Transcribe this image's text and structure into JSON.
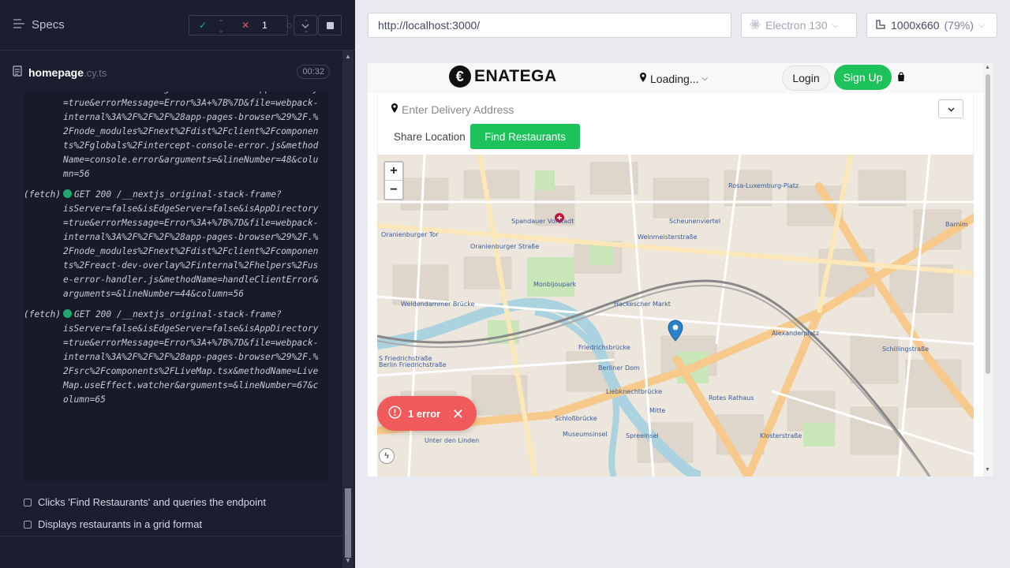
{
  "runner": {
    "specs_title": "Specs",
    "stats": {
      "passed": "--",
      "failed": "1",
      "pending": "--"
    },
    "spec_file": {
      "name": "homepage",
      "ext": ".cy.ts",
      "duration": "00:32"
    },
    "log_blocks": [
      {
        "tag": "",
        "head": "",
        "url": "isServer=false&isEdgeServer=false&isAppDirectory=true&errorMessage=Error%3A+%7B%7D&file=webpack-internal%3A%2F%2F%2F%28app-pages-browser%29%2F.%2Fnode_modules%2Fnext%2Fdist%2Fclient%2Fcomponents%2Fglobals%2Fintercept-console-error.js&methodName=console.error&arguments=&lineNumber=48&column=56"
      },
      {
        "tag": "(fetch)",
        "head": "GET 200 /__nextjs_original-stack-frame?",
        "url": "isServer=false&isEdgeServer=false&isAppDirectory=true&errorMessage=Error%3A+%7B%7D&file=webpack-internal%3A%2F%2F%2F%28app-pages-browser%29%2F.%2Fnode_modules%2Fnext%2Fdist%2Fclient%2Fcomponents%2Freact-dev-overlay%2Finternal%2Fhelpers%2Fuse-error-handler.js&methodName=handleClientError&arguments=&lineNumber=44&column=56"
      },
      {
        "tag": "(fetch)",
        "head": "GET 200 /__nextjs_original-stack-frame?",
        "url": "isServer=false&isEdgeServer=false&isAppDirectory=true&errorMessage=Error%3A+%7B%7D&file=webpack-internal%3A%2F%2F%2F%28app-pages-browser%29%2F.%2Fsrc%2Fcomponents%2FLiveMap.tsx&methodName=LiveMap.useEffect.watcher&arguments=&lineNumber=67&column=65"
      }
    ],
    "tests": [
      "Clicks 'Find Restaurants' and queries the endpoint",
      "Displays restaurants in a grid format"
    ]
  },
  "browser": {
    "url": "http://localhost:3000/",
    "browser_name": "Electron 130",
    "viewport": "1000x660",
    "zoom": "(79%)"
  },
  "app": {
    "brand": "ENATEGA",
    "location_label": "Loading...",
    "login_label": "Login",
    "signup_label": "Sign Up",
    "address_placeholder": "Enter Delivery Address",
    "share_location_label": "Share Location",
    "find_restaurants_label": "Find Restaurants",
    "error_badge": "1 error",
    "map_labels": [
      "Oranienburger Tor",
      "Oranienburger Straße",
      "Spandauer Vorstadt",
      "Scheunenviertel",
      "Rosa-Luxemburg-Platz",
      "Weinmeisterstraße",
      "Monbijoupark",
      "Hackescher Markt",
      "Alexanderplatz",
      "S Friedrichstraße",
      "Berlin Friedrichstraße",
      "Friedrichsbrücke",
      "Liebknechtbrücke",
      "Berliner Dom",
      "Rotes Rathaus",
      "Schillingstraße",
      "Klosterstraße",
      "Museumsinsel",
      "Spreeinsel",
      "Unter den Linden",
      "Schloßbrücke",
      "Mitte",
      "Weidendammer Brücke",
      "Barnim"
    ]
  },
  "colors": {
    "accent_green": "#1ec25a",
    "error_red": "#f05a5a",
    "runner_bg": "#1b1e2e"
  }
}
